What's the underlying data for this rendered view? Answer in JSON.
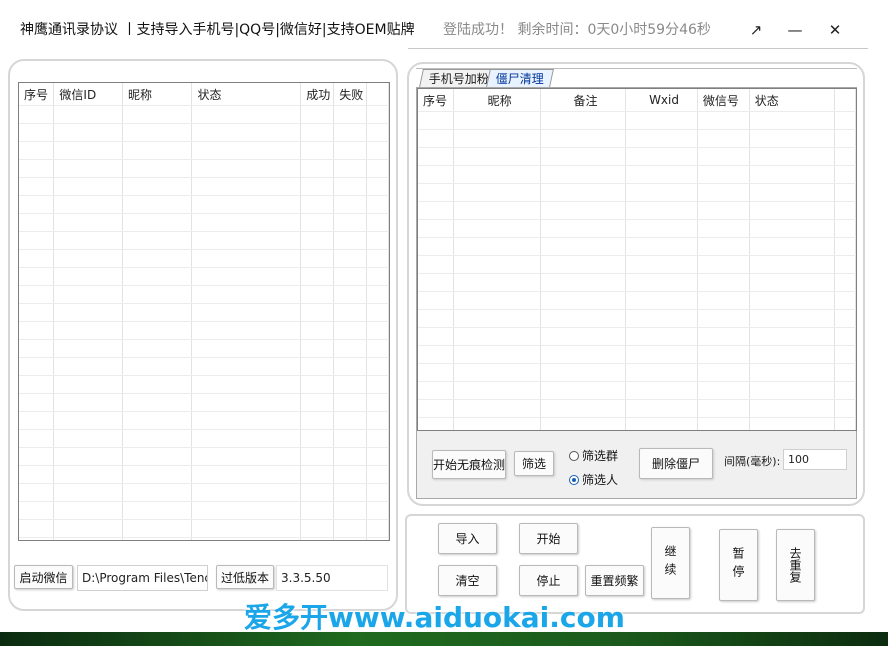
{
  "titlebar": {
    "title": "神鹰通讯录协议  丨支持导入手机号|QQ号|微信好|支持OEM贴牌",
    "status": "登陆成功！  剩余时间：0天0小时59分46秒",
    "restore_glyph": "↗",
    "minimize_glyph": "—",
    "close_glyph": "✕"
  },
  "left_grid": {
    "columns": [
      "序号",
      "微信ID",
      "昵称",
      "状态",
      "成功",
      "失败"
    ]
  },
  "left_footer": {
    "start_wechat_label": "启动微信",
    "path_value": "D:\\Program Files\\Tencent",
    "bypass_version_label": "过低版本",
    "version_value": "3.3.5.50"
  },
  "tabs": [
    {
      "label": "手机号加粉",
      "active": false
    },
    {
      "label": "僵尸清理",
      "active": true
    }
  ],
  "right_grid": {
    "columns": [
      "序号",
      "昵称",
      "备注",
      "Wxid",
      "微信号",
      "状态"
    ]
  },
  "zombie_controls": {
    "start_detect_label": "开始无痕检测",
    "filter_label": "筛选",
    "radio_group_label": "筛选群",
    "radio_person_label": "筛选人",
    "delete_zombie_label": "删除僵尸",
    "interval_label": "间隔(毫秒):",
    "interval_value": "100"
  },
  "bottom_controls": {
    "import_label": "导入",
    "start_label": "开始",
    "clear_label": "清空",
    "stop_label": "停止",
    "reset_freq_label": "重置频繁",
    "continue_label": "继续",
    "pause_label": "暂停",
    "dedupe_label": "去重复"
  },
  "watermark": {
    "text": "爱多开www.aiduokai.com"
  },
  "colors": {
    "tab_active_text": "#003399",
    "watermark": "#1aa6e8",
    "status_text": "#8a8a8a"
  }
}
